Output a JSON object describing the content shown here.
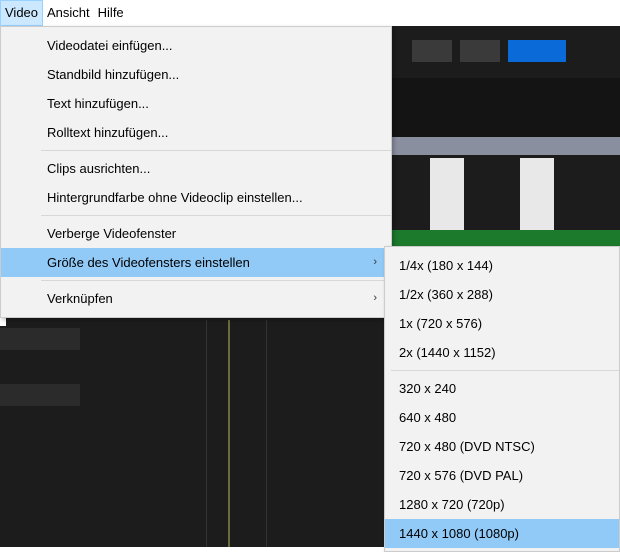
{
  "menubar": {
    "items": [
      {
        "label": "Video",
        "active": true
      },
      {
        "label": "Ansicht",
        "active": false
      },
      {
        "label": "Hilfe",
        "active": false
      }
    ]
  },
  "video_menu": {
    "group1": [
      "Videodatei einfügen...",
      "Standbild hinzufügen...",
      "Text hinzufügen...",
      "Rolltext hinzufügen..."
    ],
    "group2": [
      "Clips ausrichten...",
      "Hintergrundfarbe ohne Videoclip einstellen..."
    ],
    "group3": [
      "Verberge Videofenster",
      "Größe des Videofensters einstellen"
    ],
    "group4": [
      "Verknüpfen"
    ],
    "submenu_arrow": "›"
  },
  "size_submenu": {
    "zoom_options": [
      "1/4x (180 x 144)",
      "1/2x (360 x 288)",
      "1x (720 x 576)",
      "2x (1440 x 1152)"
    ],
    "resolution_options": [
      "320 x 240",
      "640 x 480",
      "720 x 480 (DVD NTSC)",
      "720 x 576 (DVD PAL)",
      "1280 x 720 (720p)",
      "1440 x 1080 (1080p)"
    ],
    "highlighted": "1440 x 1080 (1080p)"
  },
  "colors": {
    "menu_bg": "#f2f2f2",
    "highlight": "#91c9f7",
    "app_dark": "#1c1c1c",
    "accent_blue": "#0a6ad8"
  }
}
